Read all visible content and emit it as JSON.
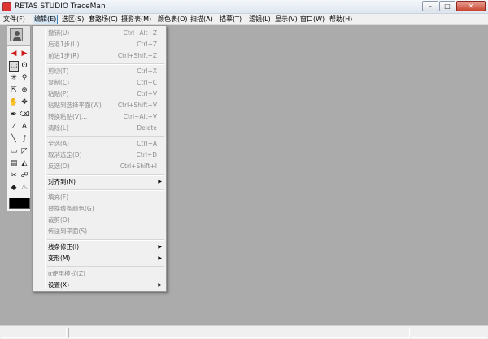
{
  "window": {
    "title": "RETAS STUDIO TraceMan",
    "minimize_glyph": "–",
    "maximize_glyph": "□",
    "close_glyph": "✕"
  },
  "menubar": {
    "items": [
      {
        "label": "文件(F)"
      },
      {
        "label": "编辑(E)",
        "active": true
      },
      {
        "label": "选区(S)"
      },
      {
        "label": "套路场(C)"
      },
      {
        "label": "摄影表(M)"
      },
      {
        "label": "颜色表(O)"
      },
      {
        "label": "扫描(A)"
      },
      {
        "label": "描摹(T)"
      },
      {
        "label": "滤镜(L)"
      },
      {
        "label": "显示(V)"
      },
      {
        "label": "窗口(W)"
      },
      {
        "label": "帮助(H)"
      }
    ]
  },
  "toolbox": {
    "tools": [
      {
        "icon": "arrow-left-red-icon",
        "glyph": "◀"
      },
      {
        "icon": "arrow-right-red-icon",
        "glyph": "▶"
      },
      {
        "icon": "rect-select-icon",
        "glyph": "⬚"
      },
      {
        "icon": "lasso-icon",
        "glyph": "ʘ"
      },
      {
        "icon": "magic-wand-icon",
        "glyph": "✳"
      },
      {
        "icon": "magnifier-icon",
        "glyph": "⚲"
      },
      {
        "icon": "select-pointer-icon",
        "glyph": "⇱"
      },
      {
        "icon": "zoom-icon",
        "glyph": "⊕"
      },
      {
        "icon": "hand-icon",
        "glyph": "✋"
      },
      {
        "icon": "move-icon",
        "glyph": "✥"
      },
      {
        "icon": "pen-icon",
        "glyph": "✒"
      },
      {
        "icon": "eraser-icon",
        "glyph": "⌫"
      },
      {
        "icon": "eyedropper-icon",
        "glyph": "⁄"
      },
      {
        "icon": "text-icon",
        "glyph": "A"
      },
      {
        "icon": "line-icon",
        "glyph": "╲"
      },
      {
        "icon": "curve-icon",
        "glyph": "∫"
      },
      {
        "icon": "rectangle-icon",
        "glyph": "▭"
      },
      {
        "icon": "polygon-icon",
        "glyph": "◸"
      },
      {
        "icon": "gradient-icon",
        "glyph": "▤"
      },
      {
        "icon": "fill-icon",
        "glyph": "◭"
      },
      {
        "icon": "knife-icon",
        "glyph": "✂"
      },
      {
        "icon": "smudge-icon",
        "glyph": "☍"
      },
      {
        "icon": "bucket-icon",
        "glyph": "◆"
      },
      {
        "icon": "drop-icon",
        "glyph": "♨"
      }
    ],
    "swatch_color": "#000000"
  },
  "edit_menu": {
    "items": [
      {
        "label": "撤销(U)",
        "shortcut": "Ctrl+Alt+Z",
        "enabled": false
      },
      {
        "label": "后退1步(U)",
        "shortcut": "Ctrl+Z",
        "enabled": false
      },
      {
        "label": "前进1步(R)",
        "shortcut": "Ctrl+Shift+Z",
        "enabled": false
      },
      {
        "sep": true
      },
      {
        "label": "剪切(T)",
        "shortcut": "Ctrl+X",
        "enabled": false
      },
      {
        "label": "复制(C)",
        "shortcut": "Ctrl+C",
        "enabled": false
      },
      {
        "label": "粘贴(P)",
        "shortcut": "Ctrl+V",
        "enabled": false
      },
      {
        "label": "粘贴到选择平面(W)",
        "shortcut": "Ctrl+Shift+V",
        "enabled": false
      },
      {
        "label": "转换粘贴(V)...",
        "shortcut": "Ctrl+Alt+V",
        "enabled": false
      },
      {
        "label": "清除(L)",
        "shortcut": "Delete",
        "enabled": false
      },
      {
        "sep": true
      },
      {
        "label": "全选(A)",
        "shortcut": "Ctrl+A",
        "enabled": false
      },
      {
        "label": "取消选定(D)",
        "shortcut": "Ctrl+D",
        "enabled": false
      },
      {
        "label": "反选(O)",
        "shortcut": "Ctrl+Shift+I",
        "enabled": false
      },
      {
        "sep": true
      },
      {
        "label": "对齐到(N)",
        "submenu": true,
        "enabled": true
      },
      {
        "sep": true
      },
      {
        "label": "填充(F)",
        "enabled": false
      },
      {
        "label": "替换线条颜色(G)",
        "enabled": false
      },
      {
        "label": "裁剪(O)",
        "enabled": false
      },
      {
        "label": "传送到平面(S)",
        "enabled": false
      },
      {
        "sep": true
      },
      {
        "label": "线条修正(I)",
        "submenu": true,
        "enabled": true
      },
      {
        "label": "变形(M)",
        "submenu": true,
        "enabled": true
      },
      {
        "sep": true
      },
      {
        "label": "α使用模式(Z)",
        "enabled": false
      },
      {
        "label": "设置(X)",
        "submenu": true,
        "enabled": true
      }
    ],
    "submenu_glyph": "▶"
  },
  "colors": {
    "workspace": "#ababab",
    "disabled_text": "#8c8c8c"
  }
}
